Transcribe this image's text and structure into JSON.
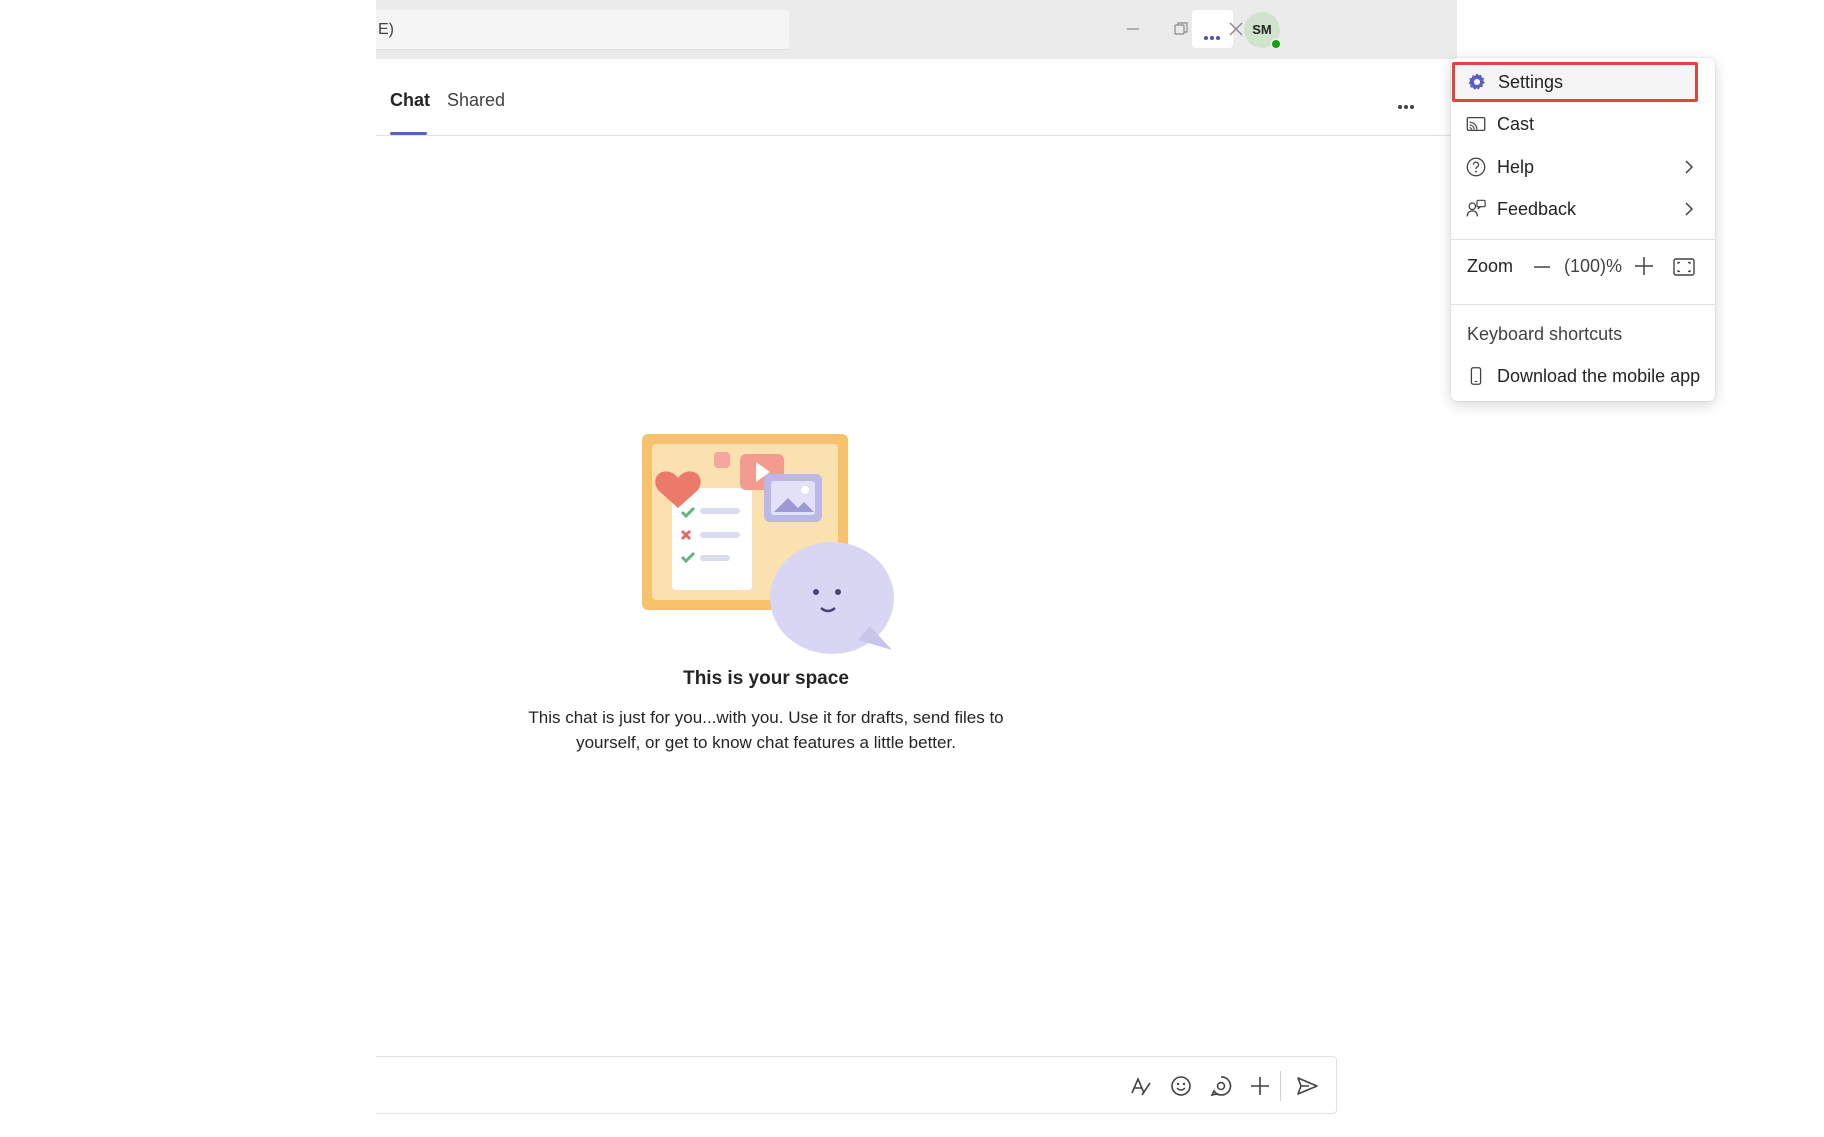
{
  "search": {
    "value": "E)"
  },
  "titlebar": {
    "more_icon": "more-horizontal-icon",
    "avatar_initials": "SM",
    "presence_status": "available",
    "window_controls": [
      "minimize-icon",
      "restore-icon",
      "close-icon"
    ]
  },
  "tabs": [
    {
      "label": "Chat",
      "active": true
    },
    {
      "label": "Shared",
      "active": false
    }
  ],
  "empty_state": {
    "title": "This is your space",
    "body": "This chat is just for you...with you. Use it for drafts, send files to yourself, or get to know chat features a little better."
  },
  "menu": {
    "settings": {
      "label": "Settings",
      "icon": "gear-icon"
    },
    "cast": {
      "label": "Cast",
      "icon": "cast-icon"
    },
    "help": {
      "label": "Help",
      "icon": "question-circle-icon"
    },
    "feedback": {
      "label": "Feedback",
      "icon": "feedback-icon"
    },
    "zoom": {
      "label": "Zoom",
      "value": "(100)%"
    },
    "keyboard_shortcuts": {
      "label": "Keyboard shortcuts"
    },
    "download_app": {
      "label": "Download the mobile app",
      "icon": "phone-icon"
    }
  },
  "composer": {
    "tools": [
      "format-icon",
      "emoji-icon",
      "loop-icon",
      "add-icon",
      "send-icon"
    ]
  },
  "colors": {
    "accent": "#5b5fc7",
    "highlight_border": "#e0443e",
    "presence_green": "#13a10e"
  }
}
